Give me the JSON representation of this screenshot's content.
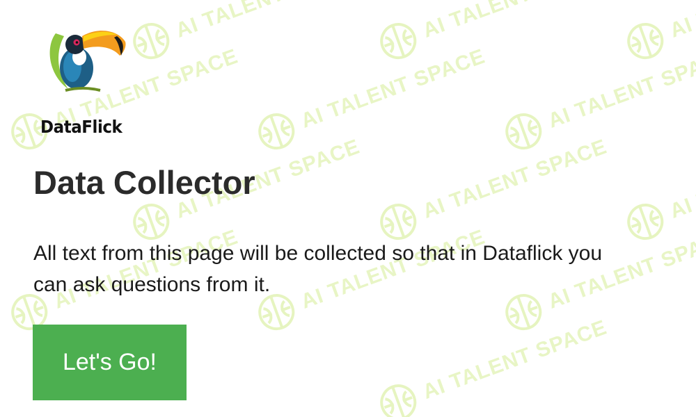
{
  "brand": {
    "logo_text": "DataFlick",
    "logo_icon": "toucan-icon"
  },
  "watermark": {
    "text": "AI TALENT SPACE",
    "icon": "brain-icon",
    "color": "#d6ec96"
  },
  "main": {
    "title": "Data Collector",
    "description": "All text from this page will be collected so that in Dataflick you can ask questions from it.",
    "button_label": "Let's Go!"
  },
  "colors": {
    "button_bg": "#4caf50",
    "button_text": "#ffffff",
    "title_text": "#2b2b2b",
    "background": "#ffffff"
  }
}
